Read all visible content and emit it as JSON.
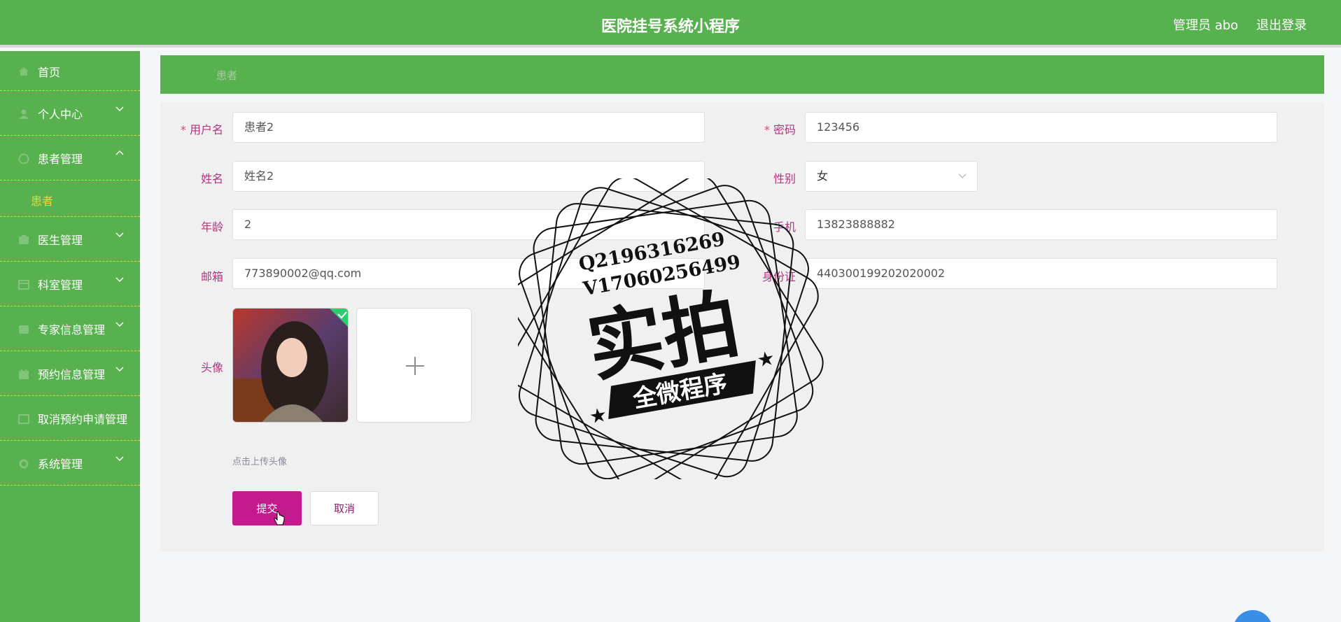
{
  "header": {
    "app_title": "医院挂号系统小程序",
    "admin_label": "管理员 abo",
    "logout_label": "退出登录"
  },
  "sidebar": {
    "items": [
      {
        "label": "首页",
        "icon": "home-icon"
      },
      {
        "label": "个人中心",
        "icon": "user-icon",
        "expandable": true
      },
      {
        "label": "患者管理",
        "icon": "patient-icon",
        "expanded": true
      },
      {
        "label": "医生管理",
        "icon": "doctor-icon",
        "expandable": true
      },
      {
        "label": "科室管理",
        "icon": "department-icon",
        "expandable": true
      },
      {
        "label": "专家信息管理",
        "icon": "expert-icon",
        "expandable": true
      },
      {
        "label": "预约信息管理",
        "icon": "appointment-icon",
        "expandable": true
      },
      {
        "label": "取消预约申请管理",
        "icon": "cancel-icon"
      },
      {
        "label": "系统管理",
        "icon": "system-icon",
        "expandable": true
      }
    ],
    "submenu": {
      "label": "患者"
    }
  },
  "breadcrumb": {
    "current": "患者"
  },
  "form": {
    "username": {
      "label": "用户名",
      "value": "患者2"
    },
    "password": {
      "label": "密码",
      "value": "123456"
    },
    "name": {
      "label": "姓名",
      "value": "姓名2"
    },
    "gender": {
      "label": "性别",
      "value": "女"
    },
    "age": {
      "label": "年龄",
      "value": "2"
    },
    "phone": {
      "label": "手机",
      "value": "13823888882"
    },
    "email": {
      "label": "邮箱",
      "value": "773890002@qq.com"
    },
    "id_card": {
      "label": "身份证",
      "value": "440300199202020002"
    },
    "avatar": {
      "label": "头像",
      "hint": "点击上传头像"
    },
    "required_mark": "*",
    "submit_label": "提交",
    "cancel_label": "取消"
  },
  "watermark": {
    "line1": "Q2196316269",
    "line2": "V17060256499",
    "big_text": "实拍",
    "banner_text": "全微程序"
  },
  "colors": {
    "primary_green": "#58b14f",
    "accent_magenta": "#c31b8d",
    "label_color": "#b5357f",
    "submenu_yellow": "#f0d43a"
  }
}
